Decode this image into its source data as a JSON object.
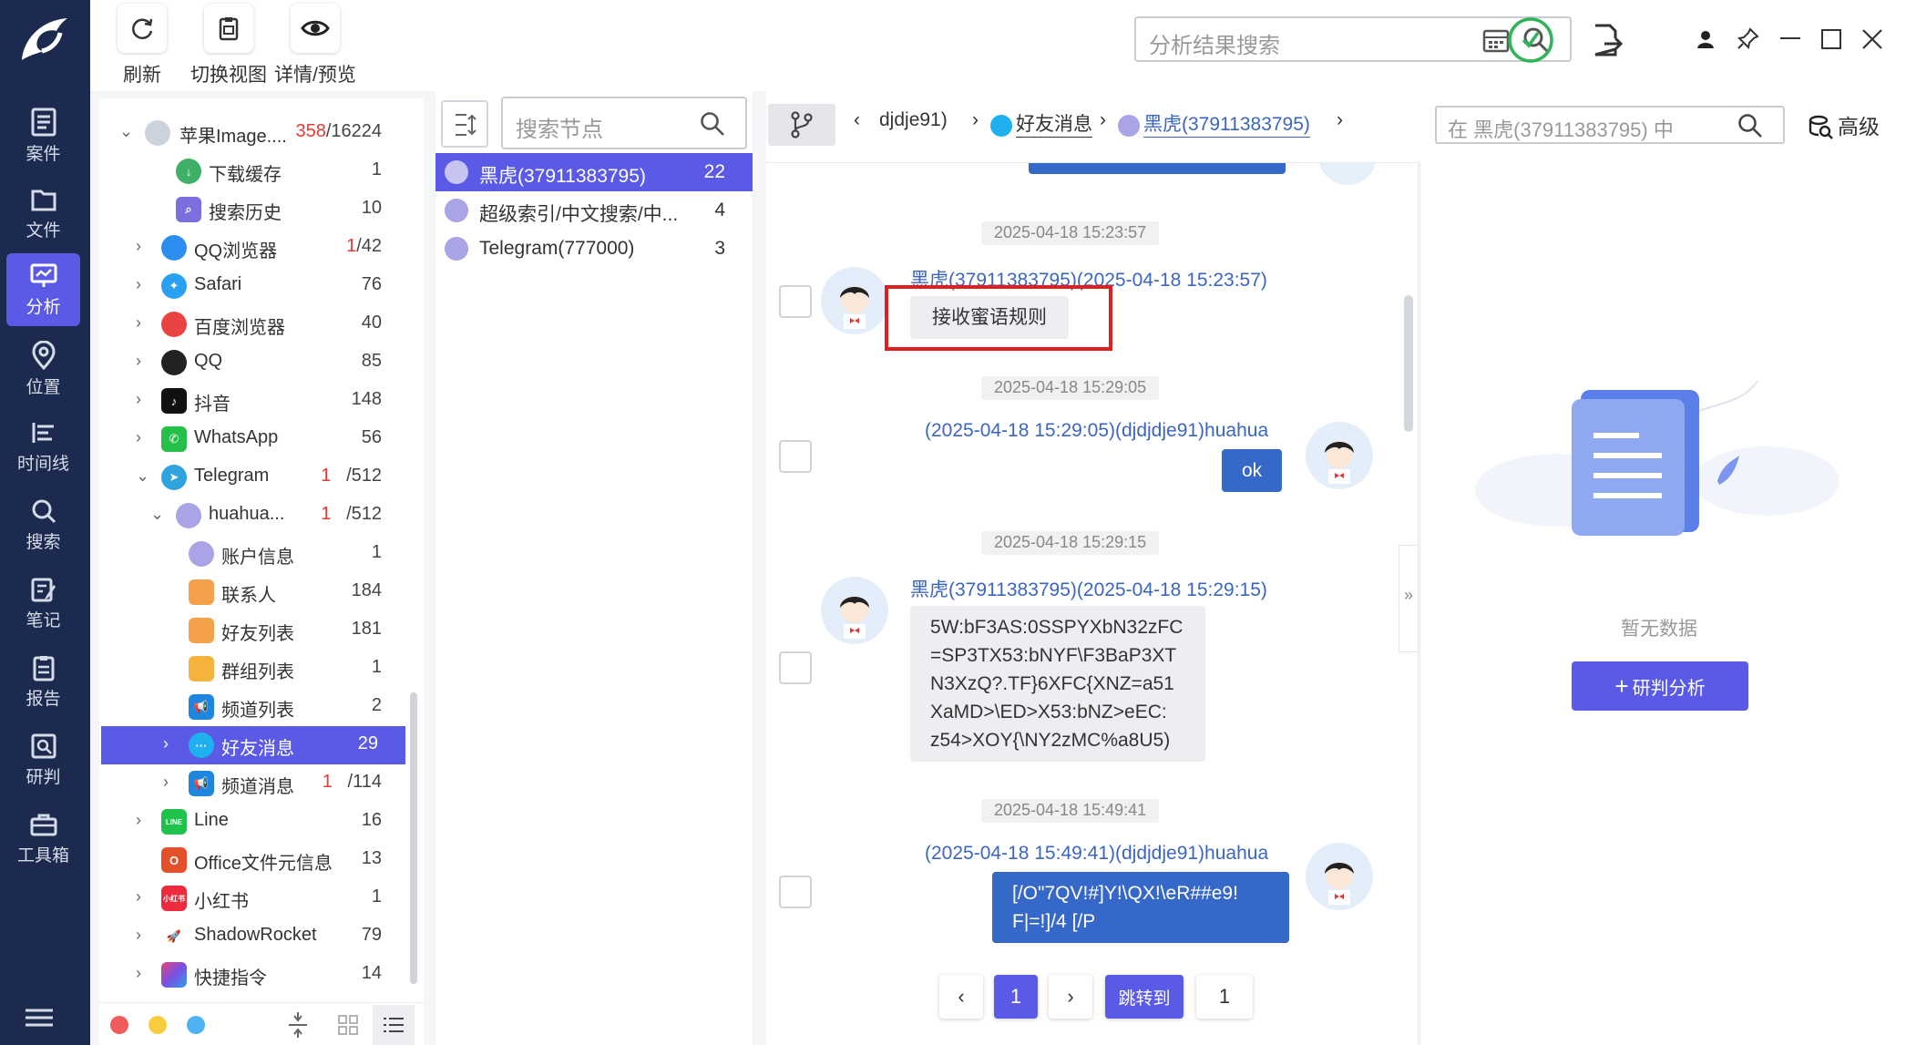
{
  "sidebar": {
    "items": [
      {
        "label": "案件",
        "icon": "case-icon"
      },
      {
        "label": "文件",
        "icon": "folder-icon"
      },
      {
        "label": "分析",
        "icon": "analysis-icon"
      },
      {
        "label": "位置",
        "icon": "location-icon"
      },
      {
        "label": "时间线",
        "icon": "timeline-icon"
      },
      {
        "label": "搜索",
        "icon": "search-icon"
      },
      {
        "label": "笔记",
        "icon": "note-icon"
      },
      {
        "label": "报告",
        "icon": "report-icon"
      },
      {
        "label": "研判",
        "icon": "judge-icon"
      },
      {
        "label": "工具箱",
        "icon": "toolbox-icon"
      }
    ],
    "active": "分析"
  },
  "toolbar": {
    "refresh_label": "刷新",
    "switch_view_label": "切换视图",
    "details_label": "详情/预览",
    "search_placeholder": "分析结果搜索"
  },
  "tree": {
    "rows": [
      {
        "label": "苹果Image....",
        "count_red": "358",
        "count": "/16224"
      },
      {
        "label": "下载缓存",
        "count": "1"
      },
      {
        "label": "搜索历史",
        "count": "10"
      },
      {
        "label": "QQ浏览器",
        "count_red": "1",
        "count": "/42"
      },
      {
        "label": "Safari",
        "count": "76"
      },
      {
        "label": "百度浏览器",
        "count": "40"
      },
      {
        "label": "QQ",
        "count": "85"
      },
      {
        "label": "抖音",
        "count": "148"
      },
      {
        "label": "WhatsApp",
        "count": "56"
      },
      {
        "label": "Telegram",
        "count_red": "1",
        "count": "/512"
      },
      {
        "label": "huahua...",
        "count_red": "1",
        "count": "/512"
      },
      {
        "label": "账户信息",
        "count": "1"
      },
      {
        "label": "联系人",
        "count": "184"
      },
      {
        "label": "好友列表",
        "count": "181"
      },
      {
        "label": "群组列表",
        "count": "1"
      },
      {
        "label": "频道列表",
        "count": "2"
      },
      {
        "label": "好友消息",
        "count": "29"
      },
      {
        "label": "频道消息",
        "count_red": "1",
        "count": "/114"
      },
      {
        "label": "Line",
        "count": "16"
      },
      {
        "label": "Office文件元信息",
        "count": "13"
      },
      {
        "label": "小红书",
        "count": "1"
      },
      {
        "label": "ShadowRocket",
        "count": "79"
      },
      {
        "label": "快捷指令",
        "count": "14"
      }
    ],
    "xhs_icon_text": "小红书",
    "line_icon_text": "LINE"
  },
  "mid": {
    "search_placeholder": "搜索节点",
    "rows": [
      {
        "label": "黑虎(37911383795)",
        "count": "22"
      },
      {
        "label": "超级索引/中文搜索/中...",
        "count": "4"
      },
      {
        "label": "Telegram(777000)",
        "count": "3"
      }
    ]
  },
  "chat": {
    "breadcrumb": [
      "djdje91)",
      "好友消息",
      "黑虎(37911383795)"
    ],
    "search_placeholder": "在 黑虎(37911383795) 中",
    "advanced_label": "高级",
    "messages": [
      {
        "time": "2025-04-18 15:23:57",
        "sender": "黑虎(37911383795)(2025-04-18 15:23:57)",
        "text": "接收蜜语规则",
        "side": "left"
      },
      {
        "time": "2025-04-18 15:29:05",
        "sender": "(2025-04-18 15:29:05)(djdjdje91)huahua",
        "text": "ok",
        "side": "right"
      },
      {
        "time": "2025-04-18 15:29:15",
        "sender": "黑虎(37911383795)(2025-04-18 15:29:15)",
        "lines": [
          "5W:bF3AS:0SSPYXbN32zFC",
          "=SP3TX53:bNYF\\F3BaP3XT",
          "N3XzQ?.TF}6XFC{XNZ=a51",
          "XaMD>\\ED>X53:bNZ>eEC:",
          "z54>XOY{\\NY2zMC%a8U5)"
        ],
        "side": "left"
      },
      {
        "time": "2025-04-18 15:49:41",
        "sender": "(2025-04-18 15:49:41)(djdjdje91)huahua",
        "lines": [
          "[/O\"7QV!#]Y!\\QX!\\eR##e9!",
          "F|=!]/4 [/P"
        ],
        "side": "right"
      }
    ],
    "pager": {
      "current": "1",
      "jump_label": "跳转到",
      "jump_value": "1"
    }
  },
  "analysis": {
    "empty_text": "暂无数据",
    "button_label": "研判分析"
  },
  "colors": {
    "accent": "#5a5ae6",
    "sidebar": "#1b2a4e",
    "bubble_right": "#3568c8",
    "link": "#3a66c2",
    "highlight_box": "#e02020"
  }
}
